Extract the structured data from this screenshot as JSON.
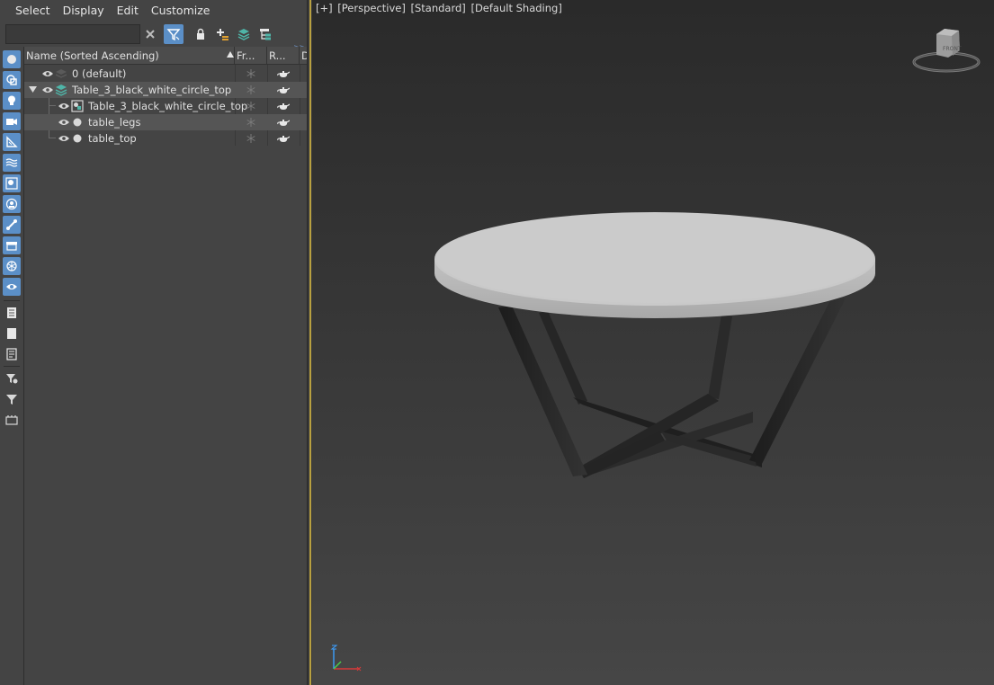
{
  "menubar": {
    "items": [
      "Select",
      "Display",
      "Edit",
      "Customize"
    ]
  },
  "search": {
    "value": "",
    "placeholder": ""
  },
  "toolbar": {
    "clear_icon": "close-icon",
    "filter_icon": "filter-icon",
    "lock_icon": "lock-icon",
    "add_layer_icon": "add-layer-icon",
    "layers_icon": "layers-icon",
    "hierarchy_icon": "hierarchy-icon"
  },
  "tree": {
    "columns": {
      "name": "Name (Sorted Ascending)",
      "frozen": "Fr...",
      "render": "R...",
      "extra": "D"
    },
    "rows": [
      {
        "label": "0 (default)",
        "type": "layer",
        "level": 0
      },
      {
        "label": "Table_3_black_white_circle_top",
        "type": "layer",
        "level": 0,
        "expanded": true
      },
      {
        "label": "Table_3_black_white_circle_top",
        "type": "group",
        "level": 1
      },
      {
        "label": "table_legs",
        "type": "object",
        "level": 1
      },
      {
        "label": "table_top",
        "type": "object",
        "level": 1
      }
    ]
  },
  "viewport": {
    "label_plus": "[+]",
    "label_view": "[Perspective]",
    "label_standard": "[Standard]",
    "label_shading": "[Default Shading]",
    "viewcube_face": "FRONT"
  },
  "colors": {
    "accent": "#5b8fc7",
    "panel_bg": "#444444",
    "viewport_top": "#2a2a2a",
    "viewport_bottom": "#464646",
    "table_top": "#c8c8c8",
    "table_legs": "#2b2b2b",
    "active_border": "#b8a040"
  }
}
